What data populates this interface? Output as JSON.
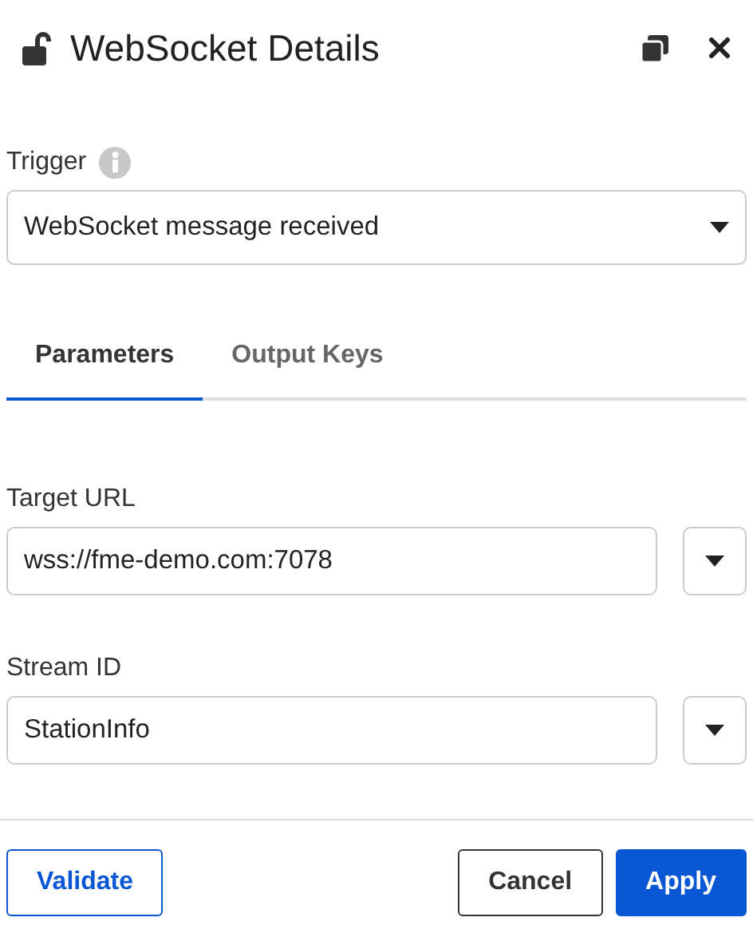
{
  "window": {
    "title": "WebSocket Details"
  },
  "trigger": {
    "label": "Trigger",
    "value": "WebSocket message received"
  },
  "tabs": [
    {
      "label": "Parameters",
      "selected": true
    },
    {
      "label": "Output Keys",
      "selected": false
    }
  ],
  "fields": [
    {
      "label": "Target URL",
      "value": "wss://fme-demo.com:7078"
    },
    {
      "label": "Stream ID",
      "value": "StationInfo"
    }
  ],
  "buttons": [
    {
      "label": "Validate",
      "kind": "outline"
    },
    {
      "label": "Cancel",
      "kind": "secondary"
    },
    {
      "label": "Apply",
      "kind": "primary"
    }
  ]
}
